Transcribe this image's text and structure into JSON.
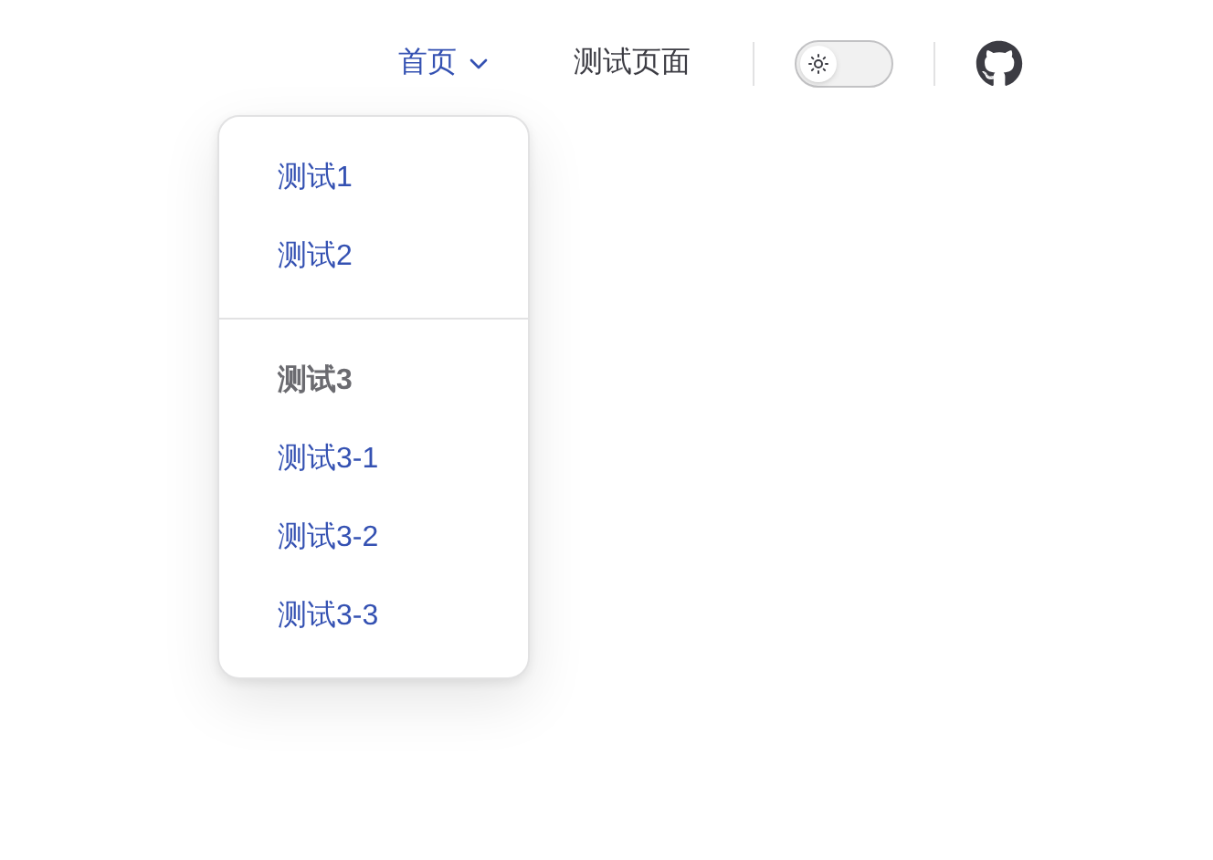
{
  "nav": {
    "items": [
      {
        "kind": "dropdown",
        "label": "首页",
        "expanded": true
      },
      {
        "kind": "link",
        "label": "测试页面"
      }
    ]
  },
  "appearance_toggle": {
    "on": false
  },
  "dropdown": {
    "groups": [
      {
        "items": [
          {
            "label": "测试1"
          },
          {
            "label": "测试2"
          }
        ]
      },
      {
        "title": "测试3",
        "items": [
          {
            "label": "测试3-1"
          },
          {
            "label": "测试3-2"
          },
          {
            "label": "测试3-3"
          }
        ]
      }
    ]
  }
}
